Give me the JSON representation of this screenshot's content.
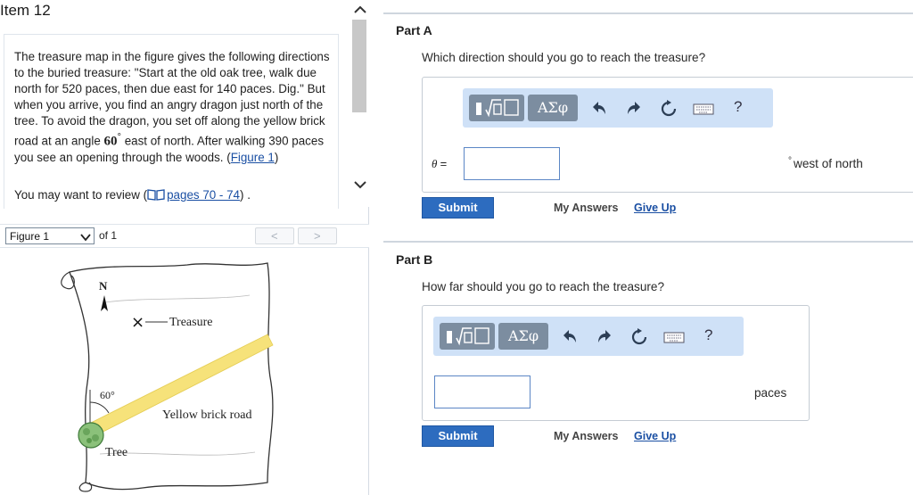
{
  "item": {
    "title": "Item 12"
  },
  "problem": {
    "text_before_angle": "The treasure map in the figure gives the following directions to the buried treasure: \"Start at the old oak tree, walk due north for 520 paces, then due east for 140 paces. Dig.\" But when you arrive, you find an angry dragon just north of the tree. To avoid the dragon, you set off along the yellow brick road at an angle ",
    "angle_value": "60",
    "angle_unit": "°",
    "text_after_angle": " east of north. After walking 390 paces you see an opening through the woods. (",
    "figure_link": "Figure 1",
    "text_end": ")",
    "review_prefix": "You may want to review (",
    "review_link": "pages 70 - 74",
    "review_suffix": ") ."
  },
  "figure_bar": {
    "selected": "Figure 1",
    "of_label": "of 1",
    "prev": "<",
    "next": ">"
  },
  "figure": {
    "north_label": "N",
    "treasure_marker": "×",
    "treasure_label": "Treasure",
    "angle_label": "60°",
    "road_label": "Yellow brick road",
    "tree_label": "Tree",
    "road_color": "#f6e27a"
  },
  "parts": [
    {
      "label": "Part A",
      "question": "Which direction should you go to reach the treasure?",
      "variable": "θ",
      "equals": "=",
      "unit_symbol": "°",
      "unit": "west of north",
      "toolbar": {
        "greek_label": "ΑΣφ",
        "help": "?"
      },
      "submit": "Submit",
      "my_answers": "My Answers",
      "give_up": "Give Up"
    },
    {
      "label": "Part B",
      "question": "How far should you go to reach the treasure?",
      "unit": "paces",
      "toolbar": {
        "greek_label": "ΑΣφ",
        "help": "?"
      },
      "submit": "Submit",
      "my_answers": "My Answers",
      "give_up": "Give Up"
    }
  ],
  "colors": {
    "accent": "#2d6cbf",
    "toolbar_bg": "#cfe1f7",
    "toolbar_button": "#7c8da0",
    "link": "#1a4fa3"
  },
  "icons": {
    "book": "book-icon",
    "undo": "undo-icon",
    "redo": "redo-icon",
    "reset": "reset-icon",
    "keyboard": "keyboard-icon",
    "matrix_template": "math-template-icon",
    "dropdown": "chevron-down-icon"
  }
}
